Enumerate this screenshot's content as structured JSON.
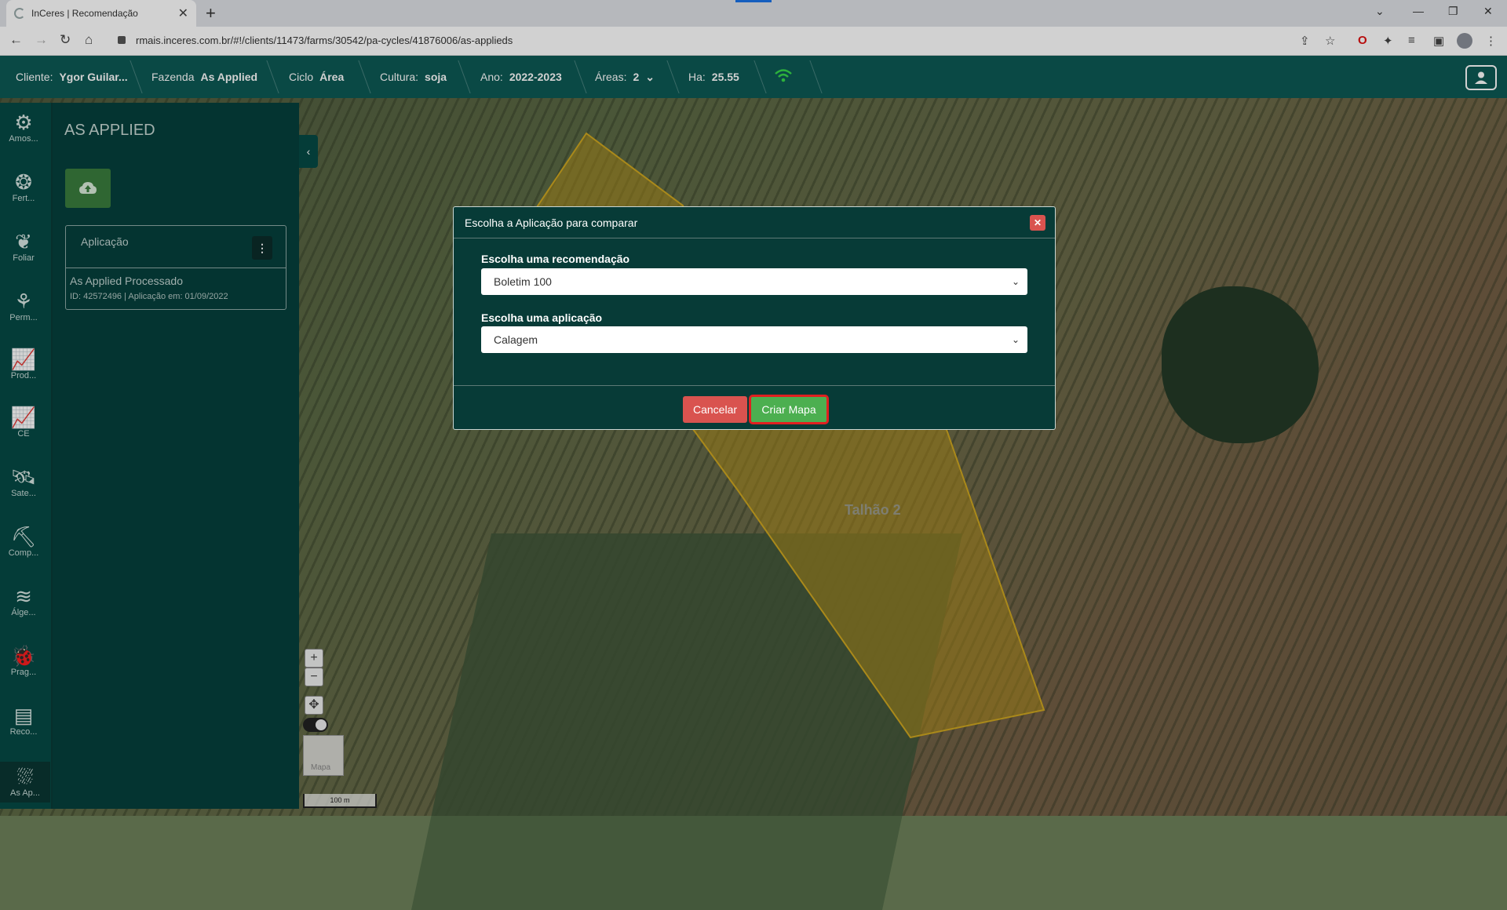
{
  "browser": {
    "tab_title": "InCeres | Recomendação",
    "tab_close": "✕",
    "new_tab": "+",
    "url": "rmais.inceres.com.br/#!/clients/11473/farms/30542/pa-cycles/41876006/as-applieds"
  },
  "header": {
    "client_label": "Cliente:",
    "client_value": "Ygor Guilar...",
    "farm_label": "Fazenda",
    "farm_value": "As Applied",
    "cycle_label": "Ciclo",
    "cycle_value": "Área",
    "crop_label": "Cultura:",
    "crop_value": "soja",
    "year_label": "Ano:",
    "year_value": "2022-2023",
    "areas_label": "Áreas:",
    "areas_value": "2",
    "ha_label": "Ha:",
    "ha_value": "25.55"
  },
  "rail": {
    "items": [
      {
        "label": "Amos...",
        "icon": "sampling-icon"
      },
      {
        "label": "Fert...",
        "icon": "fertilizer-icon"
      },
      {
        "label": "Foliar",
        "icon": "leaf-icon"
      },
      {
        "label": "Perm...",
        "icon": "permanent-crop-icon"
      },
      {
        "label": "Prod...",
        "icon": "productivity-chart-icon"
      },
      {
        "label": "CE",
        "icon": "ce-chart-icon"
      },
      {
        "label": "Sate...",
        "icon": "satellite-icon"
      },
      {
        "label": "Comp...",
        "icon": "compaction-icon"
      },
      {
        "label": "Álge...",
        "icon": "layers-icon"
      },
      {
        "label": "Prag...",
        "icon": "bug-icon"
      },
      {
        "label": "Reco...",
        "icon": "recommendation-icon"
      },
      {
        "label": "As Ap...",
        "icon": "as-applied-icon"
      }
    ]
  },
  "panel": {
    "title": "AS APPLIED",
    "card_title": "Aplicação",
    "card_name": "As Applied Processado",
    "card_meta": "ID: 42572496 | Aplicação em: 01/09/2022"
  },
  "map": {
    "field_label": "Talhão 2",
    "zoom_in": "+",
    "zoom_out": "−",
    "thumb_label": "Mapa",
    "scale_label": "100 m"
  },
  "modal": {
    "title": "Escolha a Aplicação para comparar",
    "close": "✕",
    "rec_label": "Escolha uma recomendação",
    "rec_value": "Boletim 100",
    "app_label": "Escolha uma aplicação",
    "app_value": "Calagem",
    "cancel": "Cancelar",
    "create": "Criar Mapa"
  },
  "colors": {
    "header_bg": "#0d5a55",
    "panel_bg": "#06403c",
    "field_fill": "#b8941c",
    "cancel": "#d9534f",
    "create": "#4caf50",
    "highlight": "#e02020"
  }
}
